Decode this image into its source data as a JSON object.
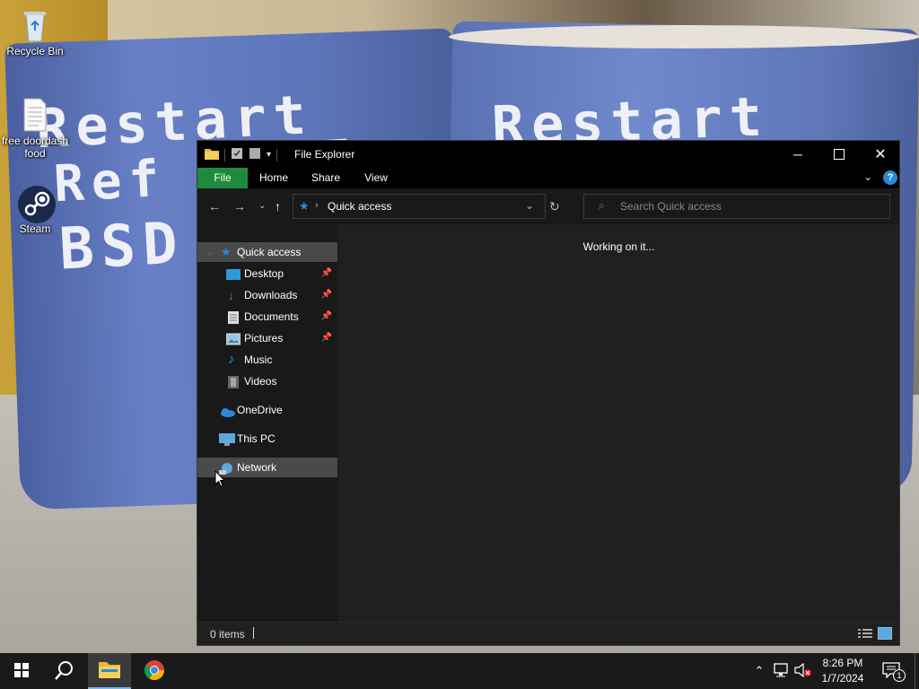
{
  "desktop": {
    "wallpaper_text_left": [
      "Restart_",
      "Ref",
      "BSD"
    ],
    "wallpaper_text_right": "Restart_",
    "icons": [
      {
        "label": "Recycle Bin",
        "icon": "recycle-bin-icon"
      },
      {
        "label": "free doordash food",
        "icon": "text-file-icon"
      },
      {
        "label": "Steam",
        "icon": "steam-icon"
      }
    ]
  },
  "window": {
    "title": "File Explorer",
    "ribbon_tabs": [
      "File",
      "Home",
      "Share",
      "View"
    ],
    "address": "Quick access",
    "search_placeholder": "Search Quick access",
    "content_message": "Working on it...",
    "status": "0 items",
    "sidebar": [
      {
        "label": "Quick access",
        "icon": "star-icon"
      },
      {
        "label": "Desktop",
        "icon": "desktop-folder-icon",
        "pinned": true
      },
      {
        "label": "Downloads",
        "icon": "download-arrow-icon",
        "pinned": true
      },
      {
        "label": "Documents",
        "icon": "document-icon",
        "pinned": true
      },
      {
        "label": "Pictures",
        "icon": "picture-icon",
        "pinned": true
      },
      {
        "label": "Music",
        "icon": "music-note-icon"
      },
      {
        "label": "Videos",
        "icon": "film-icon"
      },
      {
        "label": "OneDrive",
        "icon": "cloud-icon"
      },
      {
        "label": "This PC",
        "icon": "monitor-icon"
      },
      {
        "label": "Network",
        "icon": "network-globe-icon"
      }
    ]
  },
  "taskbar": {
    "time": "8:26 PM",
    "date": "1/7/2024",
    "notification_count": "1"
  },
  "colors": {
    "file_tab": "#1f8a3d",
    "accent_blue": "#2b88d8",
    "taskbar_bg": "#1a1a1a"
  }
}
